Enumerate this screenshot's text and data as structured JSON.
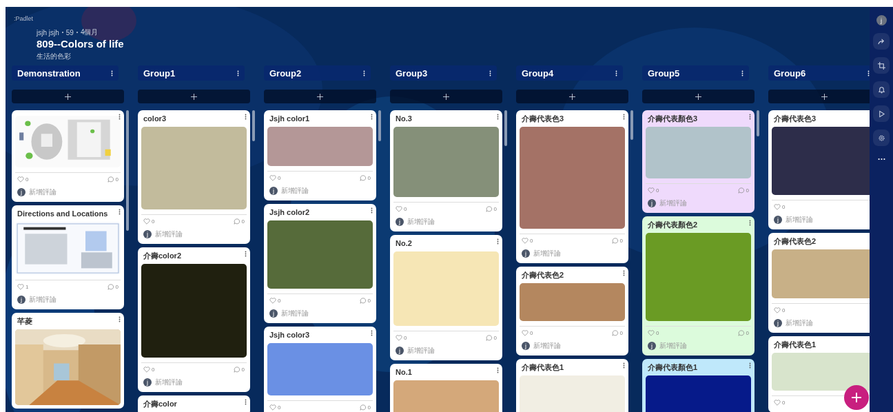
{
  "logo": ":Padlet",
  "header": {
    "author": "jsjh jsjh",
    "count": "59",
    "age": "4個月",
    "title": "809--Colors of life",
    "subtitle": "生活的色彩"
  },
  "columns": [
    {
      "title": "Demonstration",
      "cards": [
        {
          "color": "#ffffff",
          "media": {
            "kind": "map"
          },
          "likes": "0",
          "comments": "0",
          "avatar": "j",
          "prompt": "新增評論"
        },
        {
          "title": "Directions and Locations",
          "color": "#ffffff",
          "media": {
            "kind": "document"
          },
          "likes": "1",
          "comments": "0",
          "avatar": "j",
          "prompt": "新增評論"
        },
        {
          "title": "芊菱",
          "color": "#ffffff"
        }
      ]
    },
    {
      "title": "Group1",
      "cards": [
        {
          "title": "color3",
          "color": "#ffffff",
          "media": {
            "kind": "swatch",
            "color": "#c2bb9c"
          },
          "likes": "0",
          "comments": "0",
          "avatar": "j",
          "prompt": "新增評論"
        },
        {
          "title": "介壽color2",
          "color": "#ffffff",
          "media": {
            "kind": "swatch",
            "color": "#20200f"
          },
          "likes": "0",
          "comments": "0",
          "avatar": "j",
          "prompt": "新增評論"
        },
        {
          "title": "介壽color",
          "color": "#ffffff"
        }
      ]
    },
    {
      "title": "Group2",
      "cards": [
        {
          "title": "Jsjh color1",
          "color": "#ffffff",
          "media": {
            "kind": "swatch",
            "color": "#b49797"
          },
          "likes": "0",
          "comments": "0",
          "avatar": "j",
          "prompt": "新增評論"
        },
        {
          "title": "Jsjh color2",
          "color": "#ffffff",
          "media": {
            "kind": "swatch",
            "color": "#566b3a"
          },
          "likes": "0",
          "comments": "0",
          "avatar": "j",
          "prompt": "新增評論"
        },
        {
          "title": "Jsjh color3",
          "color": "#ffffff",
          "media": {
            "kind": "swatch",
            "color": "#6a90e4"
          },
          "likes": "0",
          "comments": "0"
        }
      ]
    },
    {
      "title": "Group3",
      "cards": [
        {
          "title": "No.3",
          "color": "#ffffff",
          "media": {
            "kind": "swatch",
            "color": "#859079"
          },
          "likes": "0",
          "comments": "0",
          "avatar": "j",
          "prompt": "新增評論"
        },
        {
          "title": "No.2",
          "color": "#ffffff",
          "media": {
            "kind": "swatch",
            "color": "#f6e6b5"
          },
          "likes": "0",
          "comments": "0",
          "avatar": "j",
          "prompt": "新增評論"
        },
        {
          "title": "No.1",
          "color": "#ffffff",
          "media": {
            "kind": "swatch",
            "color": "#d4a87a"
          }
        }
      ]
    },
    {
      "title": "Group4",
      "cards": [
        {
          "title": "介壽代表色3",
          "color": "#ffffff",
          "media": {
            "kind": "swatch",
            "color": "#a47266"
          },
          "likes": "0",
          "comments": "0",
          "avatar": "j",
          "prompt": "新增評論"
        },
        {
          "title": "介壽代表色2",
          "color": "#ffffff",
          "media": {
            "kind": "swatch",
            "color": "#b4875f"
          },
          "likes": "0",
          "comments": "0",
          "avatar": "j",
          "prompt": "新增評論"
        },
        {
          "title": "介壽代表色1",
          "color": "#ffffff",
          "media": {
            "kind": "swatch",
            "color": "#f1eee3"
          }
        }
      ]
    },
    {
      "title": "Group5",
      "cards": [
        {
          "title": "介壽代表顏色3",
          "color": "#efdafc",
          "media": {
            "kind": "swatch",
            "color": "#b1c3ca"
          },
          "likes": "0",
          "comments": "0",
          "avatar": "j",
          "prompt": "新增評論"
        },
        {
          "title": "介壽代表顏色2",
          "color": "#dcfbdc",
          "media": {
            "kind": "swatch",
            "color": "#6a9b24"
          },
          "likes": "0",
          "comments": "0",
          "avatar": "j",
          "prompt": "新增評論"
        },
        {
          "title": "介壽代表顏色1",
          "color": "#bfe8fb",
          "media": {
            "kind": "swatch",
            "color": "#061a8a"
          }
        }
      ]
    },
    {
      "title": "Group6",
      "cards": [
        {
          "title": "介壽代表色3",
          "color": "#ffffff",
          "media": {
            "kind": "swatch",
            "color": "#2d2d4a"
          },
          "likes": "0",
          "avatar": "j",
          "prompt": "新增評論"
        },
        {
          "title": "介壽代表色2",
          "color": "#ffffff",
          "media": {
            "kind": "swatch",
            "color": "#c8b087"
          },
          "likes": "0",
          "avatar": "j",
          "prompt": "新增評論"
        },
        {
          "title": "介壽代表色1",
          "color": "#ffffff",
          "media": {
            "kind": "swatch",
            "color": "#d8e4cc"
          },
          "likes": "0"
        }
      ]
    }
  ],
  "sidebar": {
    "avatar": "j"
  }
}
